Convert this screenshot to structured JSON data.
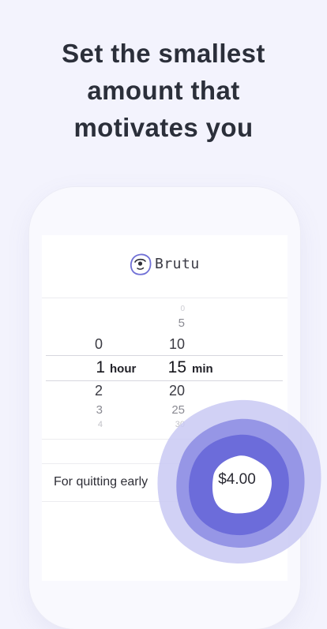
{
  "headline": {
    "line1": "Set the smallest",
    "line2": "amount that",
    "line3": "motivates you"
  },
  "app": {
    "logo_icon": "brutu-face-logo-icon",
    "name": "Brutu"
  },
  "picker": {
    "hours": {
      "above": [
        "0"
      ],
      "selected": "1",
      "below": [
        "2",
        "3",
        "4"
      ],
      "unit": "hour"
    },
    "minutes": {
      "above": [
        "0",
        "5",
        "10"
      ],
      "selected": "15",
      "below": [
        "20",
        "25",
        "30"
      ],
      "unit": "min"
    }
  },
  "penalty": {
    "label": "For quitting early",
    "amount": "$4.00"
  },
  "colors": {
    "background": "#f3f3fd",
    "accent_dark": "#6b6bd8",
    "accent_mid": "#9393e4",
    "accent_light": "#c6c6f2",
    "headline": "#2b2f3a"
  }
}
